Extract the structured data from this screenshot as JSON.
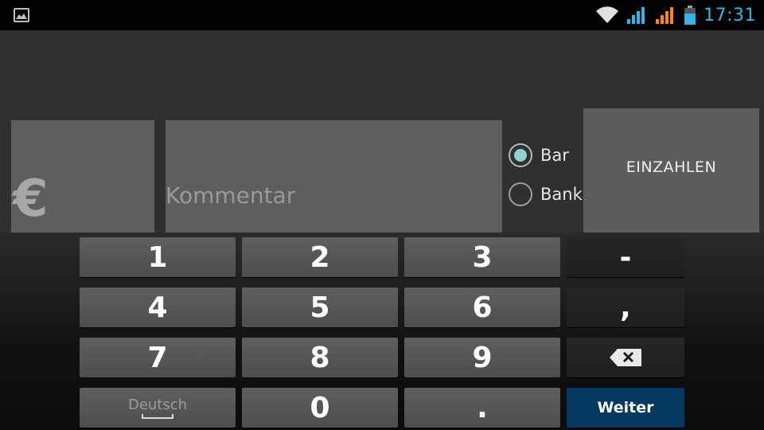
{
  "status_bar": {
    "time": "17:31",
    "icons": [
      "gallery-notification-icon",
      "wifi-icon",
      "signal-blue-icon",
      "signal-orange-icon",
      "battery-icon"
    ],
    "accent_color": "#33b5e5"
  },
  "form": {
    "currency_symbol": "€",
    "comment_placeholder": "Kommentar",
    "payment_options": [
      {
        "label": "Bar",
        "checked": true
      },
      {
        "label": "Bank",
        "checked": false
      }
    ],
    "submit_label": "EINZAHLEN"
  },
  "keyboard": {
    "rows": [
      [
        "1",
        "2",
        "3",
        "-"
      ],
      [
        "4",
        "5",
        "6",
        ","
      ],
      [
        "7",
        "8",
        "9",
        "backspace"
      ],
      [
        "Deutsch",
        "0",
        ".",
        "Weiter"
      ]
    ],
    "language_label": "Deutsch",
    "next_label": "Weiter",
    "backspace_icon": "backspace-icon",
    "next_key_color": "#03395d",
    "radio_accent_color": "#8fd1cf"
  }
}
